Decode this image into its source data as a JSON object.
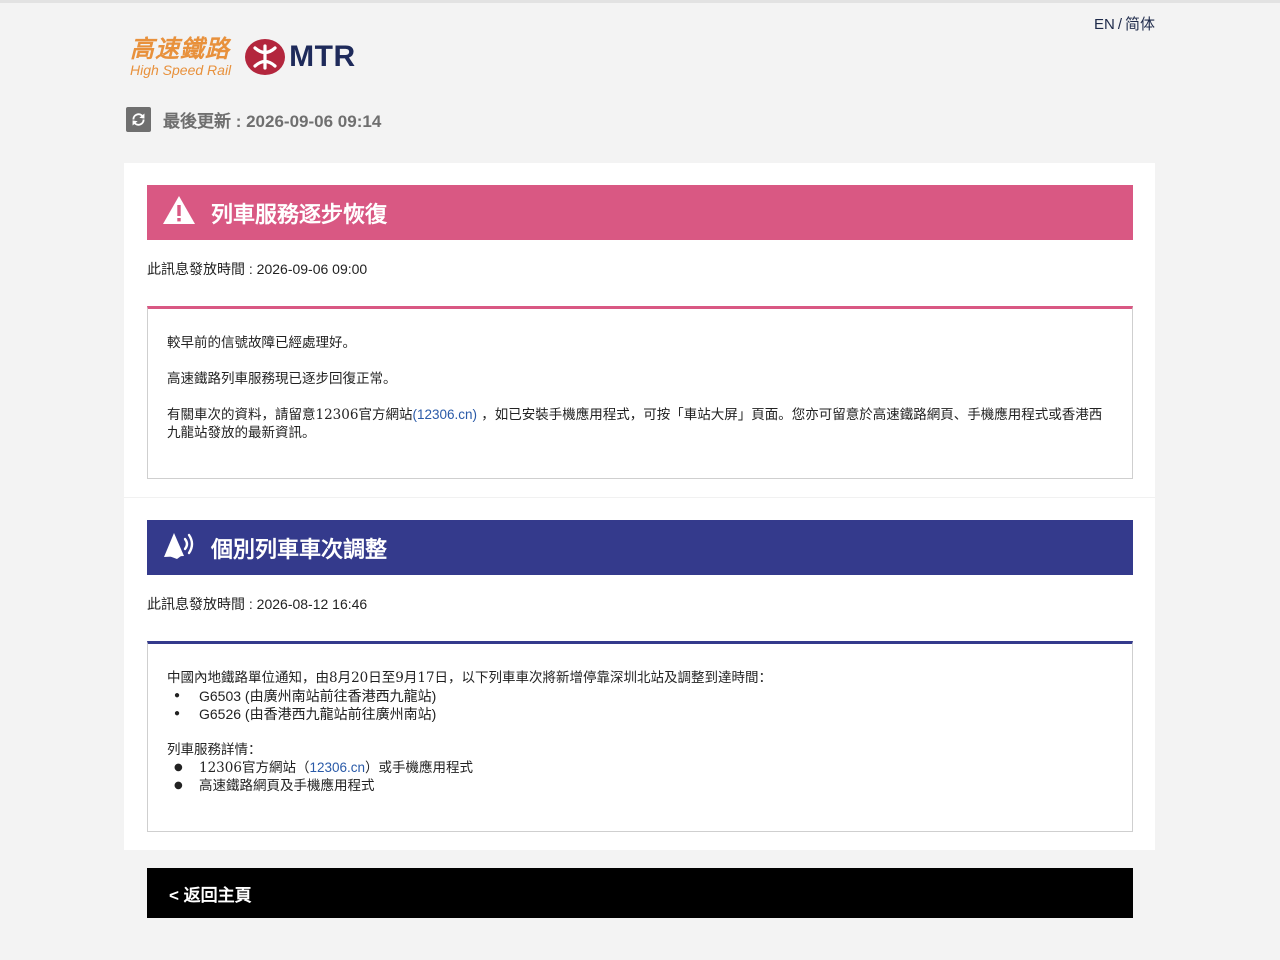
{
  "language_switch": {
    "en": "EN",
    "separator": "/",
    "sc": "简体"
  },
  "logos": {
    "hsr_zh": "高速鐵路",
    "hsr_en": "High Speed Rail",
    "mtr": "MTR"
  },
  "last_updated": {
    "label": "最後更新 : 2026-09-06 09:14"
  },
  "notices": [
    {
      "title": "列車服務逐步恢復",
      "issue_time": "此訊息發放時間 : 2026-09-06 09:00",
      "accent": "#d95883",
      "paragraphs": {
        "p1": "較早前的信號故障已經處理好。",
        "p2": "高速鐵路列車服務現已逐步回復正常。",
        "p3_before": "有關車次的資料，請留意12306官方網站",
        "p3_link": "(12306.cn)",
        "p3_after": " ，如已安裝手機應用程式，可按「車站大屏」頁面。您亦可留意於高速鐵路網頁、手機應用程式或香港西九龍站發放的最新資訊。"
      }
    },
    {
      "title": "個別列車車次調整",
      "issue_time": "此訊息發放時間 : 2026-08-12 16:46",
      "accent": "#343a8c",
      "intro": "中國內地鐵路單位通知，由8月20日至9月17日，以下列車車次將新增停靠深圳北站及調整到達時間：",
      "trains": [
        "G6503 (由廣州南站前往香港西九龍站)",
        "G6526 (由香港西九龍站前往廣州南站)"
      ],
      "details_heading": "列車服務詳情：",
      "details": {
        "item1_before": "12306官方網站（",
        "item1_link": "12306.cn",
        "item1_after": "）或手機應用程式",
        "item2": "高速鐵路網頁及手機應用程式"
      }
    }
  ],
  "home_link": "< 返回主頁"
}
